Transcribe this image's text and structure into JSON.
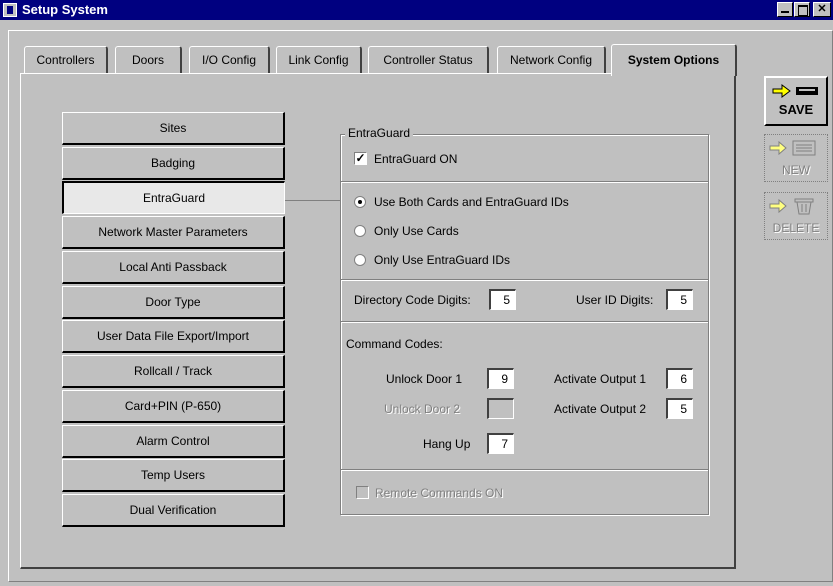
{
  "window": {
    "title": "Setup System",
    "controls": [
      "minimize-icon",
      "maximize-icon",
      "close-icon"
    ]
  },
  "tabs": [
    {
      "label": "Controllers",
      "active": false
    },
    {
      "label": "Doors",
      "active": false
    },
    {
      "label": "I/O Config",
      "active": false
    },
    {
      "label": "Link Config",
      "active": false
    },
    {
      "label": "Controller Status",
      "active": false
    },
    {
      "label": "Network Config",
      "active": false
    },
    {
      "label": "System Options",
      "active": true
    }
  ],
  "nav": [
    {
      "label": "Sites"
    },
    {
      "label": "Badging"
    },
    {
      "label": "EntraGuard",
      "active": true
    },
    {
      "label": "Network Master Parameters"
    },
    {
      "label": "Local Anti Passback"
    },
    {
      "label": "Door Type"
    },
    {
      "label": "User Data File Export/Import"
    },
    {
      "label": "Rollcall / Track"
    },
    {
      "label": "Card+PIN (P-650)"
    },
    {
      "label": "Alarm Control"
    },
    {
      "label": "Temp Users"
    },
    {
      "label": "Dual Verification"
    }
  ],
  "entraguard": {
    "group_title": "EntraGuard",
    "on_checkbox": {
      "label": "EntraGuard ON",
      "checked": true
    },
    "mode": {
      "options": [
        {
          "label": "Use Both Cards and EntraGuard IDs",
          "selected": true
        },
        {
          "label": "Only Use Cards",
          "selected": false
        },
        {
          "label": "Only Use EntraGuard IDs",
          "selected": false
        }
      ]
    },
    "directory_code_digits": {
      "label": "Directory Code Digits:",
      "value": "5"
    },
    "user_id_digits": {
      "label": "User ID Digits:",
      "value": "5"
    },
    "command_codes": {
      "label": "Command Codes:",
      "unlock_door_1": {
        "label": "Unlock Door 1",
        "value": "9"
      },
      "unlock_door_2": {
        "label": "Unlock Door 2",
        "value": "",
        "disabled": true
      },
      "hang_up": {
        "label": "Hang Up",
        "value": "7"
      },
      "activate_output_1": {
        "label": "Activate Output 1",
        "value": "6"
      },
      "activate_output_2": {
        "label": "Activate Output 2",
        "value": "5"
      }
    },
    "remote_commands": {
      "label": "Remote Commands ON",
      "checked": false,
      "disabled": true
    }
  },
  "side_buttons": {
    "save": {
      "label": "SAVE",
      "enabled": true
    },
    "new": {
      "label": "NEW",
      "enabled": false
    },
    "delete": {
      "label": "DELETE",
      "enabled": false
    }
  },
  "colors": {
    "title_bar": "#000080",
    "face": "#c0c0c0",
    "arrow": "#ffff00"
  }
}
